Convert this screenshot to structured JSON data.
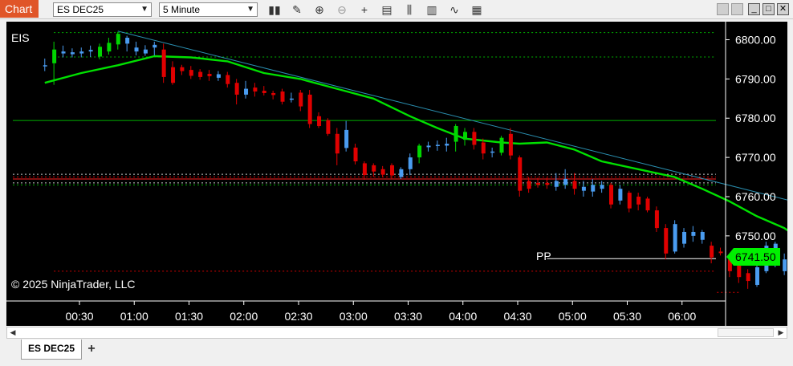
{
  "toolbar": {
    "chart_tab_label": "Chart",
    "instrument": "ES DEC25",
    "interval": "5 Minute",
    "icons": [
      "bars-type-icon",
      "draw-tool-icon",
      "zoom-in-icon",
      "zoom-out-icon",
      "crosshair-icon",
      "data-box-icon",
      "indicators-icon",
      "strategies-icon",
      "chart-style-icon",
      "properties-icon"
    ]
  },
  "window_controls": {
    "minimize": "minimize-icon",
    "maximize": "maximize-icon",
    "close": "close-icon"
  },
  "bottom_tabs": {
    "active_tab": "ES DEC25",
    "add_tab_icon": "plus-icon"
  },
  "colors": {
    "up": "#00d600",
    "down": "#e00000",
    "neutral": "#4a9cf0",
    "ema": "#00e000",
    "trendline": "#2a8fb0",
    "price_marker": "#00f000"
  },
  "chart_data": {
    "type": "candlestick",
    "indicator_label": "EIS",
    "copyright": "© 2025 NinjaTrader, LLC",
    "x_ticks": [
      "00:30",
      "01:00",
      "01:30",
      "02:00",
      "02:30",
      "03:00",
      "03:30",
      "04:00",
      "04:30",
      "05:00",
      "05:30",
      "06:00"
    ],
    "y_ticks": [
      "6800.00",
      "6790.00",
      "6780.00",
      "6770.00",
      "6760.00",
      "6750.00"
    ],
    "ylim": [
      6733.4,
      6804.6
    ],
    "last_price": "6741.50",
    "pivot_label": "PP",
    "candles": [
      {
        "t": "00:11",
        "o": 6793.3,
        "h": 6795.2,
        "l": 6792.0,
        "c": 6793.5,
        "col": "blue"
      },
      {
        "t": "00:16",
        "o": 6794.0,
        "h": 6799.5,
        "l": 6788.5,
        "c": 6797.5,
        "col": "green"
      },
      {
        "t": "00:21",
        "o": 6797.0,
        "h": 6798.5,
        "l": 6795.5,
        "c": 6796.5,
        "col": "blue"
      },
      {
        "t": "00:26",
        "o": 6796.3,
        "h": 6797.8,
        "l": 6795.5,
        "c": 6796.8,
        "col": "blue"
      },
      {
        "t": "00:31",
        "o": 6796.5,
        "h": 6798.0,
        "l": 6795.5,
        "c": 6797.0,
        "col": "blue"
      },
      {
        "t": "00:36",
        "o": 6797.0,
        "h": 6798.5,
        "l": 6795.6,
        "c": 6797.4,
        "col": "blue"
      },
      {
        "t": "00:41",
        "o": 6795.7,
        "h": 6799.0,
        "l": 6795.0,
        "c": 6798.2,
        "col": "green"
      },
      {
        "t": "00:46",
        "o": 6797.0,
        "h": 6800.5,
        "l": 6796.2,
        "c": 6799.2,
        "col": "green"
      },
      {
        "t": "00:51",
        "o": 6798.8,
        "h": 6802.0,
        "l": 6797.5,
        "c": 6801.5,
        "col": "green"
      },
      {
        "t": "00:56",
        "o": 6799.0,
        "h": 6801.0,
        "l": 6797.0,
        "c": 6800.5,
        "col": "blue"
      },
      {
        "t": "01:01",
        "o": 6798.0,
        "h": 6799.5,
        "l": 6796.0,
        "c": 6797.0,
        "col": "blue"
      },
      {
        "t": "01:06",
        "o": 6796.5,
        "h": 6798.6,
        "l": 6795.9,
        "c": 6797.5,
        "col": "blue"
      },
      {
        "t": "01:11",
        "o": 6798.7,
        "h": 6799.5,
        "l": 6796.0,
        "c": 6798.0,
        "col": "blue"
      },
      {
        "t": "01:16",
        "o": 6797.5,
        "h": 6799.0,
        "l": 6789.0,
        "c": 6790.5,
        "col": "red"
      },
      {
        "t": "01:21",
        "o": 6793.0,
        "h": 6794.5,
        "l": 6788.5,
        "c": 6789.0,
        "col": "red"
      },
      {
        "t": "01:26",
        "o": 6793.0,
        "h": 6793.6,
        "l": 6791.0,
        "c": 6792.0,
        "col": "red"
      },
      {
        "t": "01:31",
        "o": 6792.3,
        "h": 6793.3,
        "l": 6790.0,
        "c": 6790.8,
        "col": "red"
      },
      {
        "t": "01:36",
        "o": 6791.8,
        "h": 6792.5,
        "l": 6789.8,
        "c": 6790.5,
        "col": "red"
      },
      {
        "t": "01:41",
        "o": 6791.3,
        "h": 6792.3,
        "l": 6789.5,
        "c": 6790.7,
        "col": "red"
      },
      {
        "t": "01:46",
        "o": 6791.2,
        "h": 6792.0,
        "l": 6789.5,
        "c": 6790.3,
        "col": "blue"
      },
      {
        "t": "01:51",
        "o": 6791.0,
        "h": 6791.8,
        "l": 6787.8,
        "c": 6788.7,
        "col": "red"
      },
      {
        "t": "01:56",
        "o": 6789.0,
        "h": 6790.0,
        "l": 6783.5,
        "c": 6786.0,
        "col": "red"
      },
      {
        "t": "02:01",
        "o": 6787.5,
        "h": 6789.5,
        "l": 6785.0,
        "c": 6786.0,
        "col": "blue"
      },
      {
        "t": "02:06",
        "o": 6787.8,
        "h": 6789.0,
        "l": 6785.5,
        "c": 6786.8,
        "col": "red"
      },
      {
        "t": "02:11",
        "o": 6787.0,
        "h": 6788.2,
        "l": 6785.8,
        "c": 6786.4,
        "col": "red"
      },
      {
        "t": "02:16",
        "o": 6786.4,
        "h": 6787.0,
        "l": 6784.8,
        "c": 6785.9,
        "col": "red"
      },
      {
        "t": "02:21",
        "o": 6786.8,
        "h": 6787.5,
        "l": 6783.5,
        "c": 6784.2,
        "col": "red"
      },
      {
        "t": "02:26",
        "o": 6785.0,
        "h": 6786.5,
        "l": 6784.0,
        "c": 6784.8,
        "col": "blue"
      },
      {
        "t": "02:31",
        "o": 6786.5,
        "h": 6787.2,
        "l": 6781.8,
        "c": 6783.0,
        "col": "red"
      },
      {
        "t": "02:36",
        "o": 6786.0,
        "h": 6787.2,
        "l": 6777.5,
        "c": 6778.5,
        "col": "red"
      },
      {
        "t": "02:41",
        "o": 6780.5,
        "h": 6781.5,
        "l": 6777.5,
        "c": 6778.0,
        "col": "red"
      },
      {
        "t": "02:46",
        "o": 6779.5,
        "h": 6780.0,
        "l": 6775.5,
        "c": 6776.0,
        "col": "red"
      },
      {
        "t": "02:51",
        "o": 6776.0,
        "h": 6777.5,
        "l": 6768.0,
        "c": 6771.0,
        "col": "red"
      },
      {
        "t": "02:56",
        "o": 6777.0,
        "h": 6779.3,
        "l": 6771.5,
        "c": 6772.4,
        "col": "blue"
      },
      {
        "t": "03:01",
        "o": 6772.5,
        "h": 6773.5,
        "l": 6768.2,
        "c": 6769.0,
        "col": "red"
      },
      {
        "t": "03:06",
        "o": 6768.5,
        "h": 6769.0,
        "l": 6764.3,
        "c": 6765.5,
        "col": "red"
      },
      {
        "t": "03:11",
        "o": 6768.0,
        "h": 6768.5,
        "l": 6765.0,
        "c": 6766.4,
        "col": "red"
      },
      {
        "t": "03:16",
        "o": 6767.0,
        "h": 6767.8,
        "l": 6765.0,
        "c": 6765.6,
        "col": "red"
      },
      {
        "t": "03:21",
        "o": 6768.0,
        "h": 6768.5,
        "l": 6764.5,
        "c": 6765.4,
        "col": "red"
      },
      {
        "t": "03:26",
        "o": 6767.0,
        "h": 6767.5,
        "l": 6764.5,
        "c": 6765.0,
        "col": "blue"
      },
      {
        "t": "03:31",
        "o": 6767.0,
        "h": 6771.0,
        "l": 6765.5,
        "c": 6770.0,
        "col": "blue"
      },
      {
        "t": "03:36",
        "o": 6770.0,
        "h": 6773.5,
        "l": 6768.5,
        "c": 6773.0,
        "col": "green"
      },
      {
        "t": "03:41",
        "o": 6773.0,
        "h": 6774.0,
        "l": 6771.5,
        "c": 6772.6,
        "col": "blue"
      },
      {
        "t": "03:46",
        "o": 6773.0,
        "h": 6774.3,
        "l": 6771.7,
        "c": 6773.2,
        "col": "blue"
      },
      {
        "t": "03:51",
        "o": 6773.0,
        "h": 6775.0,
        "l": 6771.5,
        "c": 6773.5,
        "col": "blue"
      },
      {
        "t": "03:56",
        "o": 6774.0,
        "h": 6778.5,
        "l": 6771.5,
        "c": 6778.0,
        "col": "green"
      },
      {
        "t": "04:01",
        "o": 6774.5,
        "h": 6777.5,
        "l": 6773.0,
        "c": 6776.5,
        "col": "green"
      },
      {
        "t": "04:06",
        "o": 6776.5,
        "h": 6777.5,
        "l": 6772.0,
        "c": 6773.2,
        "col": "red"
      },
      {
        "t": "04:11",
        "o": 6773.8,
        "h": 6774.8,
        "l": 6769.5,
        "c": 6771.0,
        "col": "red"
      },
      {
        "t": "04:16",
        "o": 6771.5,
        "h": 6772.5,
        "l": 6770.0,
        "c": 6771.2,
        "col": "blue"
      },
      {
        "t": "04:21",
        "o": 6771.2,
        "h": 6775.5,
        "l": 6770.5,
        "c": 6775.0,
        "col": "green"
      },
      {
        "t": "04:26",
        "o": 6776.0,
        "h": 6777.5,
        "l": 6769.5,
        "c": 6770.5,
        "col": "red"
      },
      {
        "t": "04:31",
        "o": 6770.0,
        "h": 6770.5,
        "l": 6760.0,
        "c": 6761.5,
        "col": "red"
      },
      {
        "t": "04:36",
        "o": 6764.0,
        "h": 6765.0,
        "l": 6761.0,
        "c": 6762.0,
        "col": "red"
      },
      {
        "t": "04:41",
        "o": 6763.5,
        "h": 6764.8,
        "l": 6762.3,
        "c": 6763.0,
        "col": "red"
      },
      {
        "t": "04:46",
        "o": 6763.5,
        "h": 6764.8,
        "l": 6762.0,
        "c": 6763.0,
        "col": "red"
      },
      {
        "t": "04:51",
        "o": 6764.0,
        "h": 6766.0,
        "l": 6761.5,
        "c": 6762.5,
        "col": "blue"
      },
      {
        "t": "04:56",
        "o": 6764.5,
        "h": 6767.0,
        "l": 6762.0,
        "c": 6763.0,
        "col": "blue"
      },
      {
        "t": "05:01",
        "o": 6764.0,
        "h": 6766.0,
        "l": 6760.5,
        "c": 6762.0,
        "col": "red"
      },
      {
        "t": "05:06",
        "o": 6762.5,
        "h": 6764.0,
        "l": 6760.0,
        "c": 6761.5,
        "col": "blue"
      },
      {
        "t": "05:11",
        "o": 6763.0,
        "h": 6764.5,
        "l": 6760.0,
        "c": 6761.3,
        "col": "blue"
      },
      {
        "t": "05:16",
        "o": 6763.0,
        "h": 6764.0,
        "l": 6761.0,
        "c": 6762.0,
        "col": "blue"
      },
      {
        "t": "05:21",
        "o": 6763.0,
        "h": 6763.5,
        "l": 6757.0,
        "c": 6758.0,
        "col": "red"
      },
      {
        "t": "05:26",
        "o": 6762.0,
        "h": 6763.0,
        "l": 6758.0,
        "c": 6759.0,
        "col": "blue"
      },
      {
        "t": "05:31",
        "o": 6761.0,
        "h": 6761.5,
        "l": 6756.0,
        "c": 6757.0,
        "col": "red"
      },
      {
        "t": "05:36",
        "o": 6760.0,
        "h": 6761.0,
        "l": 6756.5,
        "c": 6758.0,
        "col": "red"
      },
      {
        "t": "05:41",
        "o": 6759.5,
        "h": 6760.0,
        "l": 6756.0,
        "c": 6756.5,
        "col": "red"
      },
      {
        "t": "05:46",
        "o": 6756.5,
        "h": 6757.5,
        "l": 6751.0,
        "c": 6752.0,
        "col": "red"
      },
      {
        "t": "05:51",
        "o": 6752.0,
        "h": 6753.0,
        "l": 6744.0,
        "c": 6745.5,
        "col": "red"
      },
      {
        "t": "05:56",
        "o": 6746.0,
        "h": 6754.0,
        "l": 6745.5,
        "c": 6753.0,
        "col": "blue"
      },
      {
        "t": "06:01",
        "o": 6748.0,
        "h": 6752.0,
        "l": 6747.0,
        "c": 6751.0,
        "col": "blue"
      },
      {
        "t": "06:06",
        "o": 6751.0,
        "h": 6752.5,
        "l": 6748.5,
        "c": 6750.0,
        "col": "blue"
      },
      {
        "t": "06:11",
        "o": 6751.0,
        "h": 6751.5,
        "l": 6748.0,
        "c": 6749.0,
        "col": "blue"
      },
      {
        "t": "06:16",
        "o": 6747.5,
        "h": 6748.5,
        "l": 6743.0,
        "c": 6744.5,
        "col": "red"
      },
      {
        "t": "06:21",
        "o": 6746.0,
        "h": 6747.0,
        "l": 6745.0,
        "c": 6745.6,
        "col": "red"
      },
      {
        "t": "06:26",
        "o": 6744.0,
        "h": 6745.5,
        "l": 6739.5,
        "c": 6741.0,
        "col": "red"
      },
      {
        "t": "06:31",
        "o": 6743.0,
        "h": 6743.5,
        "l": 6738.0,
        "c": 6739.5,
        "col": "red"
      },
      {
        "t": "06:36",
        "o": 6740.5,
        "h": 6741.5,
        "l": 6736.5,
        "c": 6738.5,
        "col": "red"
      },
      {
        "t": "06:41",
        "o": 6737.5,
        "h": 6742.5,
        "l": 6737.0,
        "c": 6742.0,
        "col": "blue"
      },
      {
        "t": "06:46",
        "o": 6741.0,
        "h": 6748.5,
        "l": 6740.5,
        "c": 6747.5,
        "col": "blue"
      },
      {
        "t": "06:51",
        "o": 6743.0,
        "h": 6748.5,
        "l": 6742.0,
        "c": 6748.0,
        "col": "blue"
      },
      {
        "t": "06:56",
        "o": 6744.0,
        "h": 6745.5,
        "l": 6740.0,
        "c": 6741.0,
        "col": "blue"
      },
      {
        "t": "07:01",
        "o": 6744.0,
        "h": 6744.5,
        "l": 6737.0,
        "c": 6739.0,
        "col": "red"
      },
      {
        "t": "07:06",
        "o": 6740.0,
        "h": 6743.0,
        "l": 6739.5,
        "c": 6741.5,
        "col": "blue"
      }
    ],
    "ema": [
      {
        "t": "00:11",
        "v": 6789.0
      },
      {
        "t": "00:31",
        "v": 6791.5
      },
      {
        "t": "00:51",
        "v": 6793.5
      },
      {
        "t": "01:11",
        "v": 6795.8
      },
      {
        "t": "01:31",
        "v": 6795.5
      },
      {
        "t": "01:51",
        "v": 6794.5
      },
      {
        "t": "02:11",
        "v": 6791.5
      },
      {
        "t": "02:31",
        "v": 6790.0
      },
      {
        "t": "02:51",
        "v": 6787.5
      },
      {
        "t": "03:11",
        "v": 6785.0
      },
      {
        "t": "03:31",
        "v": 6780.5
      },
      {
        "t": "03:46",
        "v": 6777.5
      },
      {
        "t": "04:01",
        "v": 6774.8
      },
      {
        "t": "04:21",
        "v": 6773.8
      },
      {
        "t": "04:31",
        "v": 6773.5
      },
      {
        "t": "04:46",
        "v": 6773.8
      },
      {
        "t": "05:01",
        "v": 6772.0
      },
      {
        "t": "05:16",
        "v": 6769.0
      },
      {
        "t": "05:36",
        "v": 6767.0
      },
      {
        "t": "05:56",
        "v": 6765.0
      },
      {
        "t": "06:11",
        "v": 6762.0
      },
      {
        "t": "06:26",
        "v": 6758.8
      },
      {
        "t": "06:41",
        "v": 6755.0
      },
      {
        "t": "06:56",
        "v": 6752.0
      },
      {
        "t": "07:06",
        "v": 6748.8
      }
    ],
    "trendline": [
      {
        "t": "00:51",
        "v": 6802.2
      },
      {
        "t": "07:16",
        "v": 6757.0
      }
    ],
    "hlines": [
      {
        "v": 6801.8,
        "color": "#00b000",
        "style": "dotted",
        "from": "00:16"
      },
      {
        "v": 6795.6,
        "color": "#00b000",
        "style": "dotted",
        "from": "00:16"
      },
      {
        "v": 6779.4,
        "color": "#00b000",
        "style": "solid",
        "from": "start"
      },
      {
        "v": 6765.7,
        "color": "#c8c8c8",
        "style": "dotted",
        "from": "start"
      },
      {
        "v": 6765.0,
        "color": "#d00000",
        "style": "dotted",
        "from": "start"
      },
      {
        "v": 6764.5,
        "color": "#ff2020",
        "style": "solid",
        "from": "start"
      },
      {
        "v": 6763.5,
        "color": "#c8c8c8",
        "style": "dotted",
        "from": "start"
      },
      {
        "v": 6763.0,
        "color": "#00b000",
        "style": "dotted",
        "from": "start"
      },
      {
        "v": 6744.2,
        "color": "#ffffff",
        "style": "solid",
        "from": "04:46"
      },
      {
        "v": 6741.0,
        "color": "#d00000",
        "style": "dotted",
        "from": "00:16"
      },
      {
        "v": 6735.6,
        "color": "#d00000",
        "style": "dotted",
        "from": "06:31"
      }
    ]
  }
}
